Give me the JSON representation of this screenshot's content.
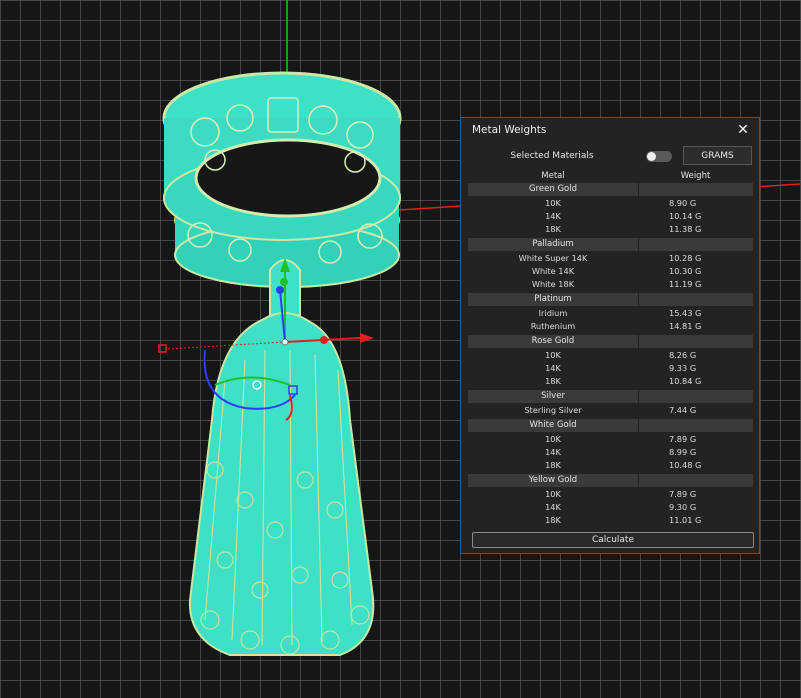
{
  "panel": {
    "title": "Metal Weights",
    "selected_materials_label": "Selected Materials",
    "toggle_on": false,
    "unit_label": "GRAMS",
    "columns": {
      "metal": "Metal",
      "weight": "Weight"
    },
    "groups": [
      {
        "name": "Green Gold",
        "rows": [
          {
            "metal": "10K",
            "weight": "8.90 G"
          },
          {
            "metal": "14K",
            "weight": "10.14 G"
          },
          {
            "metal": "18K",
            "weight": "11.38 G"
          }
        ]
      },
      {
        "name": "Palladium",
        "rows": [
          {
            "metal": "White Super 14K",
            "weight": "10.28 G"
          },
          {
            "metal": "White 14K",
            "weight": "10.30 G"
          },
          {
            "metal": "White 18K",
            "weight": "11.19 G"
          }
        ]
      },
      {
        "name": "Platinum",
        "rows": [
          {
            "metal": "Iridium",
            "weight": "15.43 G"
          },
          {
            "metal": "Ruthenium",
            "weight": "14.81 G"
          }
        ]
      },
      {
        "name": "Rose Gold",
        "rows": [
          {
            "metal": "10K",
            "weight": "8.26 G"
          },
          {
            "metal": "14K",
            "weight": "9.33 G"
          },
          {
            "metal": "18K",
            "weight": "10.84 G"
          }
        ]
      },
      {
        "name": "Silver",
        "rows": [
          {
            "metal": "Sterling Silver",
            "weight": "7.44 G"
          }
        ]
      },
      {
        "name": "White Gold",
        "rows": [
          {
            "metal": "10K",
            "weight": "7.89 G"
          },
          {
            "metal": "14K",
            "weight": "8.99 G"
          },
          {
            "metal": "18K",
            "weight": "10.48 G"
          }
        ]
      },
      {
        "name": "Yellow Gold",
        "rows": [
          {
            "metal": "10K",
            "weight": "7.89 G"
          },
          {
            "metal": "14K",
            "weight": "9.30 G"
          },
          {
            "metal": "18K",
            "weight": "11.01 G"
          }
        ]
      }
    ],
    "calculate_label": "Calculate"
  },
  "colors": {
    "model": "#3ee0c6",
    "model_edge": "#b8e6a0",
    "axis_x": "#e02020",
    "axis_y": "#22c022",
    "axis_z": "#2a3cff",
    "panel_border": "#1f5f9e"
  },
  "icons": {
    "close": "close-icon",
    "gizmo": "transform-gizmo-icon"
  }
}
